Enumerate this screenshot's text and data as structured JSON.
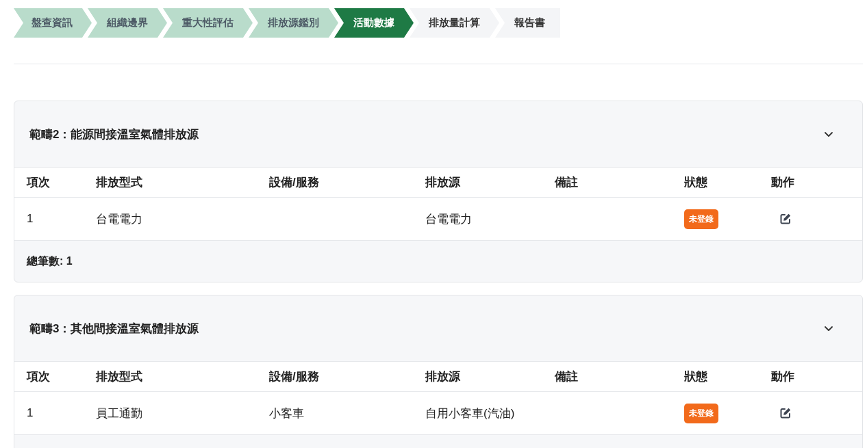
{
  "steps": [
    {
      "label": "盤查資訊",
      "completed": true,
      "selected": false
    },
    {
      "label": "組織邊界",
      "completed": true,
      "selected": false
    },
    {
      "label": "重大性評估",
      "completed": true,
      "selected": false
    },
    {
      "label": "排放源鑑別",
      "completed": true,
      "selected": false
    },
    {
      "label": "活動數據",
      "completed": false,
      "selected": true
    },
    {
      "label": "排放量計算",
      "completed": false,
      "selected": false
    },
    {
      "label": "報告書",
      "completed": false,
      "selected": false
    }
  ],
  "sections": [
    {
      "title": "範疇2：能源間接溫室氣體排放源",
      "expanded": true,
      "columns": [
        "項次",
        "排放型式",
        "設備/服務",
        "排放源",
        "備註",
        "狀態",
        "動作"
      ],
      "rows": [
        {
          "cells": [
            "1",
            "台電電力",
            "",
            "台電電力",
            ""
          ],
          "status": "未登錄"
        }
      ],
      "total": "總筆數: 1"
    },
    {
      "title": "範疇3：其他間接溫室氣體排放源",
      "expanded": true,
      "columns": [
        "項次",
        "排放型式",
        "設備/服務",
        "排放源",
        "備註",
        "狀態",
        "動作"
      ],
      "rows": [
        {
          "cells": [
            "1",
            "員工通勤",
            "小客車",
            "自用小客車(汽油)",
            ""
          ],
          "status": "未登錄"
        }
      ]
    }
  ]
}
